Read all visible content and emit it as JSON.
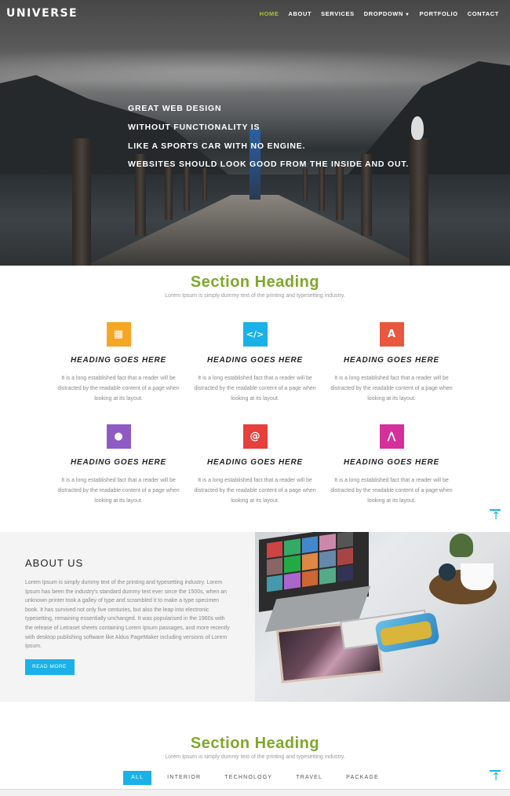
{
  "header": {
    "logo": "UNIVERSE",
    "nav": [
      {
        "label": "HOME",
        "active": true
      },
      {
        "label": "ABOUT",
        "active": false
      },
      {
        "label": "SERVICES",
        "active": false
      },
      {
        "label": "DROPDOWN",
        "active": false
      },
      {
        "label": "PORTFOLIO",
        "active": false
      },
      {
        "label": "CONTACT",
        "active": false
      }
    ]
  },
  "hero": {
    "lines": [
      "GREAT WEB DESIGN",
      "WITHOUT FUNCTIONALITY IS",
      "LIKE A SPORTS CAR WITH NO ENGINE.",
      "WEBSITES SHOULD LOOK GOOD FROM THE INSIDE AND OUT."
    ]
  },
  "services": {
    "heading": "Section Heading",
    "subheading": "Lorem Ipsum is simply dummy text of the printing and typesetting industry.",
    "features": [
      {
        "icon": "calculator-icon",
        "color": "#f6a623",
        "title": "HEADING GOES HERE",
        "text": "It is a long established fact that a reader will be distracted by the readable content of a page when looking at its layout."
      },
      {
        "icon": "code-icon",
        "color": "#1ab1e8",
        "title": "HEADING GOES HERE",
        "text": "It is a long established fact that a reader will be distracted by the readable content of a page when looking at its layout."
      },
      {
        "icon": "angular-icon",
        "color": "#e9573f",
        "title": "HEADING GOES HERE",
        "text": "It is a long established fact that a reader will be distracted by the readable content of a page when looking at its layout."
      },
      {
        "icon": "apple-icon",
        "color": "#8e5bc4",
        "title": "HEADING GOES HERE",
        "text": "It is a long established fact that a reader will be distracted by the readable content of a page when looking at its layout."
      },
      {
        "icon": "at-icon",
        "color": "#e63f3c",
        "title": "HEADING GOES HERE",
        "text": "It is a long established fact that a reader will be distracted by the readable content of a page when looking at its layout."
      },
      {
        "icon": "app-store-icon",
        "color": "#d52f9c",
        "title": "HEADING GOES HERE",
        "text": "It is a long established fact that a reader will be distracted by the readable content of a page when looking at its layout."
      }
    ]
  },
  "about": {
    "title": "ABOUT US",
    "text": "Lorem Ipsum is simply dummy text of the printing and typesetting industry. Lorem Ipsum has been the industry's standard dummy text ever since the 1500s, when an unknown printer took a galley of type and scrambled it to make a type specimen book. It has survived not only five centuries, but also the leap into electronic typesetting, remaining essentially unchanged. It was popularised in the 1960s with the release of Letraset sheets containing Lorem Ipsum passages, and more recently with desktop publishing software like Aldus PageMaker including versions of Lorem Ipsum.",
    "button": "READ MORE"
  },
  "portfolio": {
    "heading": "Section Heading",
    "subheading": "Lorem Ipsum is simply dummy text of the printing and typesetting industry.",
    "tabs": [
      {
        "label": "ALL",
        "active": true
      },
      {
        "label": "INTERIOR",
        "active": false
      },
      {
        "label": "TECHNOLOGY",
        "active": false
      },
      {
        "label": "TRAVEL",
        "active": false
      },
      {
        "label": "PACKAGE",
        "active": false
      }
    ]
  },
  "colors": {
    "accent_green": "#7fa82b",
    "accent_blue": "#1ab1e8",
    "nav_active": "#a8c23a"
  }
}
